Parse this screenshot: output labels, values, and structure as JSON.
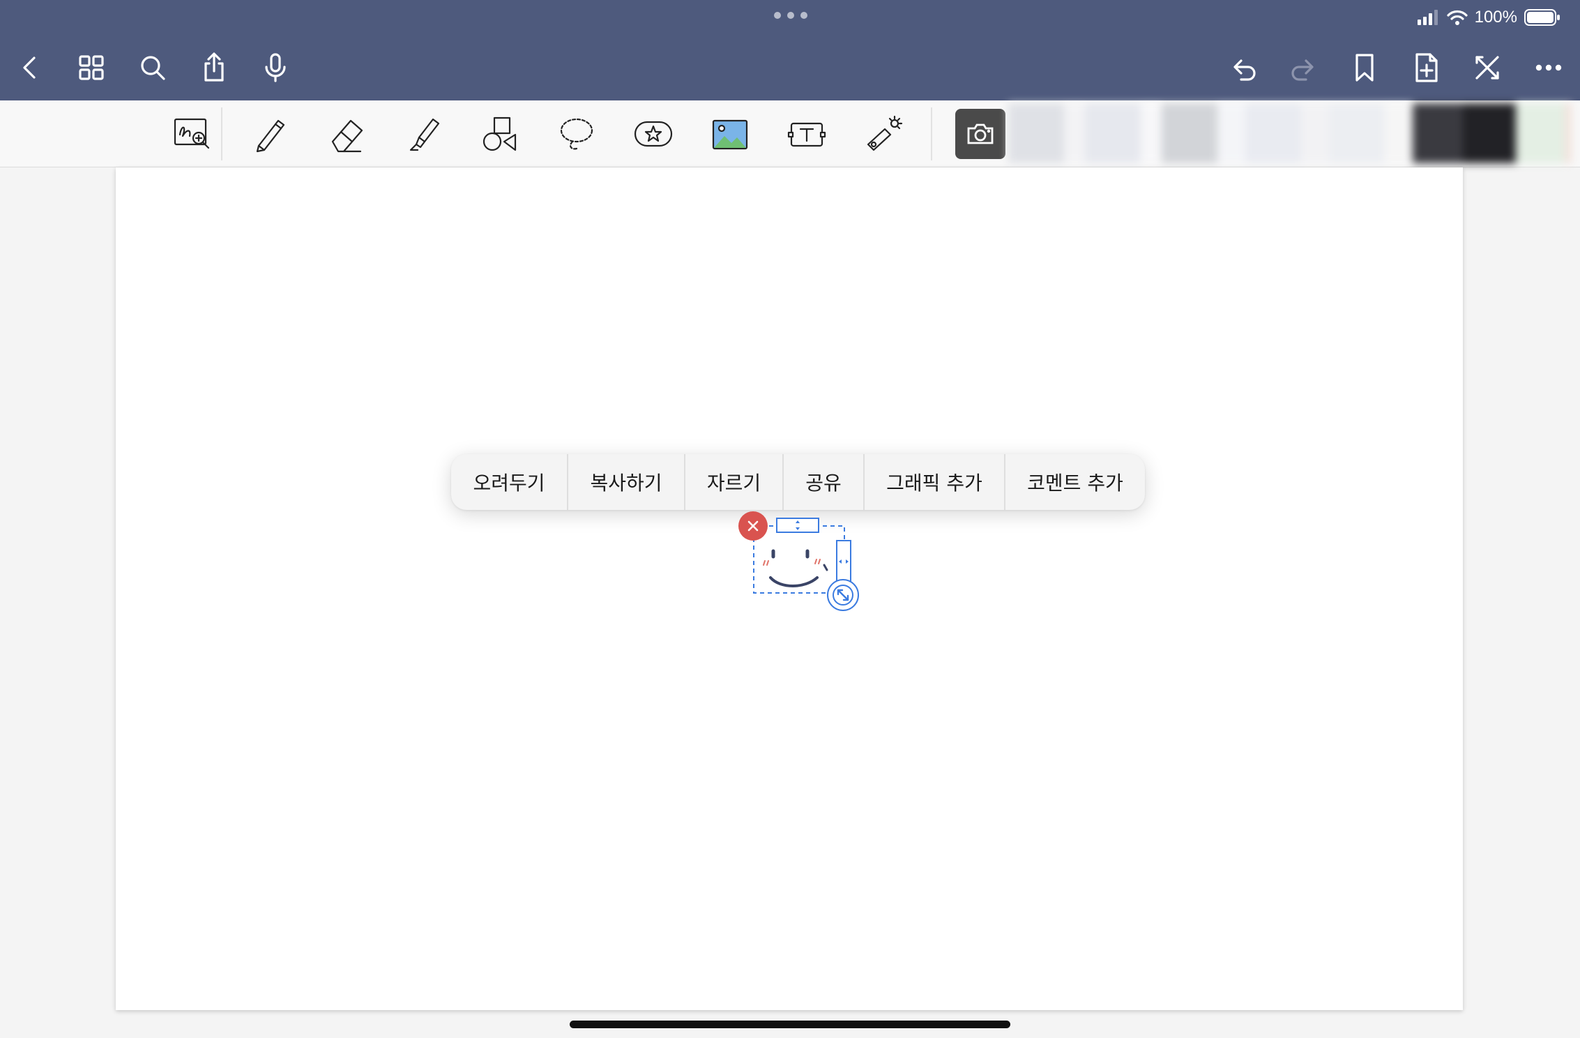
{
  "status_bar": {
    "battery_percent": "100%",
    "signal_icon": "cellular-signal-icon",
    "wifi_icon": "wifi-icon",
    "battery_icon": "battery-icon"
  },
  "nav_bar": {
    "left_icons": [
      "back-chevron-icon",
      "grid-icon",
      "search-icon",
      "share-icon",
      "microphone-icon"
    ],
    "right_icons": [
      "undo-icon",
      "redo-icon",
      "bookmark-icon",
      "add-page-icon",
      "close-fullscreen-icon",
      "more-icon"
    ],
    "redo_enabled": false
  },
  "toolbar": {
    "tools": [
      "zoom-window-icon",
      "pen-icon",
      "eraser-icon",
      "highlighter-icon",
      "shapes-icon",
      "lasso-icon",
      "sticker-icon",
      "image-icon",
      "text-box-icon",
      "laser-pointer-icon"
    ],
    "camera_icon": "camera-icon"
  },
  "context_menu": {
    "items": [
      "오려두기",
      "복사하기",
      "자르기",
      "공유",
      "그래픽 추가",
      "코멘트 추가"
    ]
  },
  "colors": {
    "nav_bar": "#4e5a7d",
    "delete_badge": "#d9534f",
    "selection": "#3b7be0",
    "face_stroke": "#3a4466",
    "blush": "#e0746a"
  }
}
